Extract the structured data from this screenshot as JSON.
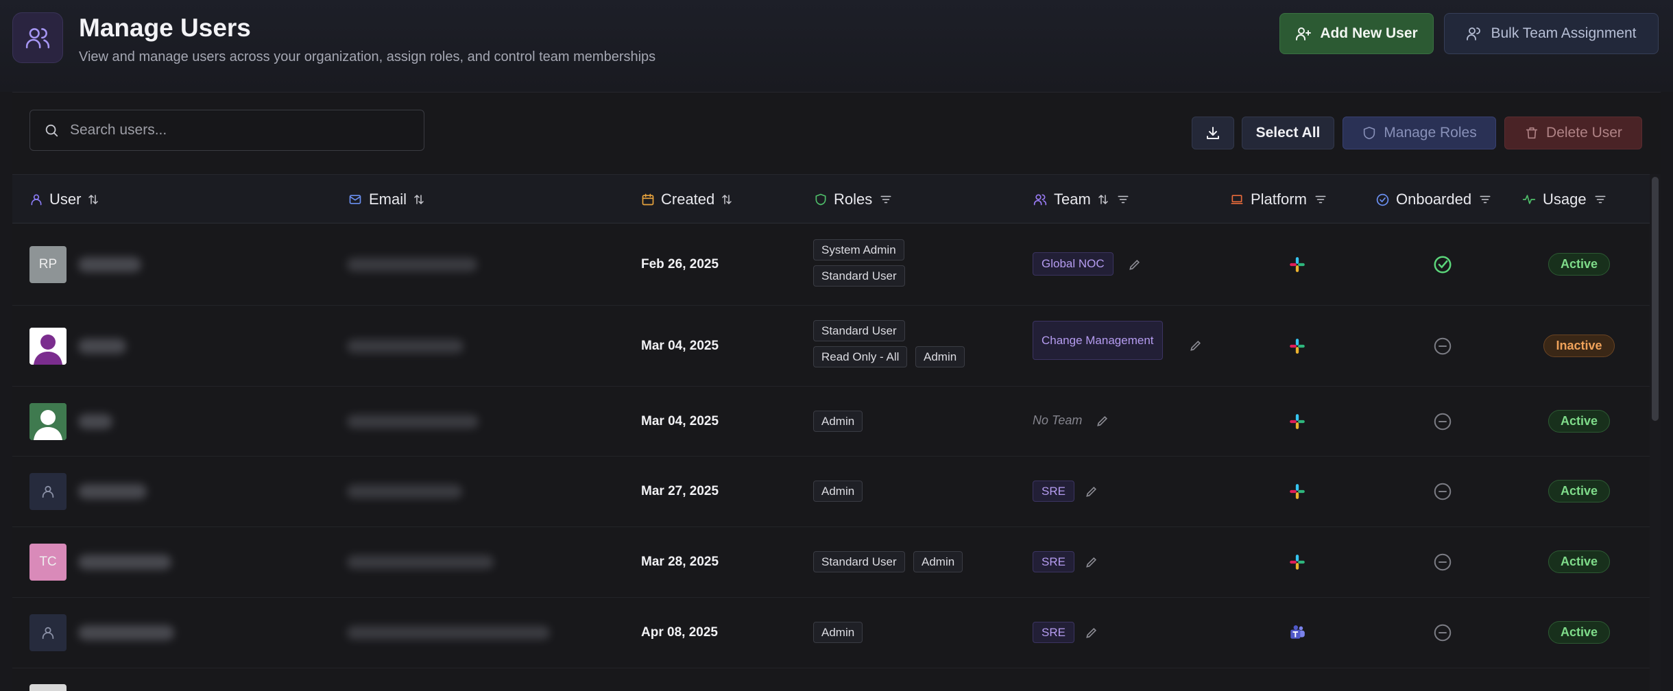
{
  "header": {
    "title": "Manage Users",
    "subtitle": "View and manage users across your organization, assign roles, and control team memberships",
    "add_button": "Add New User",
    "bulk_button": "Bulk Team Assignment"
  },
  "toolbar": {
    "search_placeholder": "Search users...",
    "select_all": "Select All",
    "manage_roles": "Manage Roles",
    "delete_user": "Delete User"
  },
  "columns": {
    "user": "User",
    "email": "Email",
    "created": "Created",
    "roles": "Roles",
    "team": "Team",
    "platform": "Platform",
    "onboarded": "Onboarded",
    "usage": "Usage"
  },
  "colors": {
    "accent_purple": "#8b7cf6",
    "active_green": "#7fdc8a",
    "inactive_orange": "#f0a25a",
    "add_button_bg": "#2c5a33"
  },
  "rows": [
    {
      "avatar_type": "initials",
      "initials": "RP",
      "avatar_color": "#8e9496",
      "created": "Feb 26, 2025",
      "roles": [
        "System Admin",
        "Standard User"
      ],
      "team": "Global NOC",
      "platform": "slack-icon",
      "onboarded": true,
      "usage": "Active"
    },
    {
      "avatar_type": "photo-purple",
      "initials": "",
      "avatar_color": "#ffffff",
      "created": "Mar 04, 2025",
      "roles": [
        "Standard User",
        "Read Only - All",
        "Admin"
      ],
      "team": "Change Management",
      "platform": "slack-icon",
      "onboarded": false,
      "usage": "Inactive"
    },
    {
      "avatar_type": "photo-green",
      "initials": "",
      "avatar_color": "#3f7a4f",
      "created": "Mar 04, 2025",
      "roles": [
        "Admin"
      ],
      "team": "",
      "no_team_label": "No Team",
      "platform": "slack-icon",
      "onboarded": false,
      "usage": "Active"
    },
    {
      "avatar_type": "generic",
      "initials": "",
      "avatar_color": "#262b3d",
      "created": "Mar 27, 2025",
      "roles": [
        "Admin"
      ],
      "team": "SRE",
      "platform": "slack-icon",
      "onboarded": false,
      "usage": "Active"
    },
    {
      "avatar_type": "initials",
      "initials": "TC",
      "avatar_color": "#d98ab9",
      "created": "Mar 28, 2025",
      "roles": [
        "Standard User",
        "Admin"
      ],
      "team": "SRE",
      "platform": "slack-icon",
      "onboarded": false,
      "usage": "Active"
    },
    {
      "avatar_type": "generic",
      "initials": "",
      "avatar_color": "#262b3d",
      "created": "Apr 08, 2025",
      "roles": [
        "Admin"
      ],
      "team": "SRE",
      "platform": "teams-icon",
      "onboarded": false,
      "usage": "Active"
    }
  ]
}
